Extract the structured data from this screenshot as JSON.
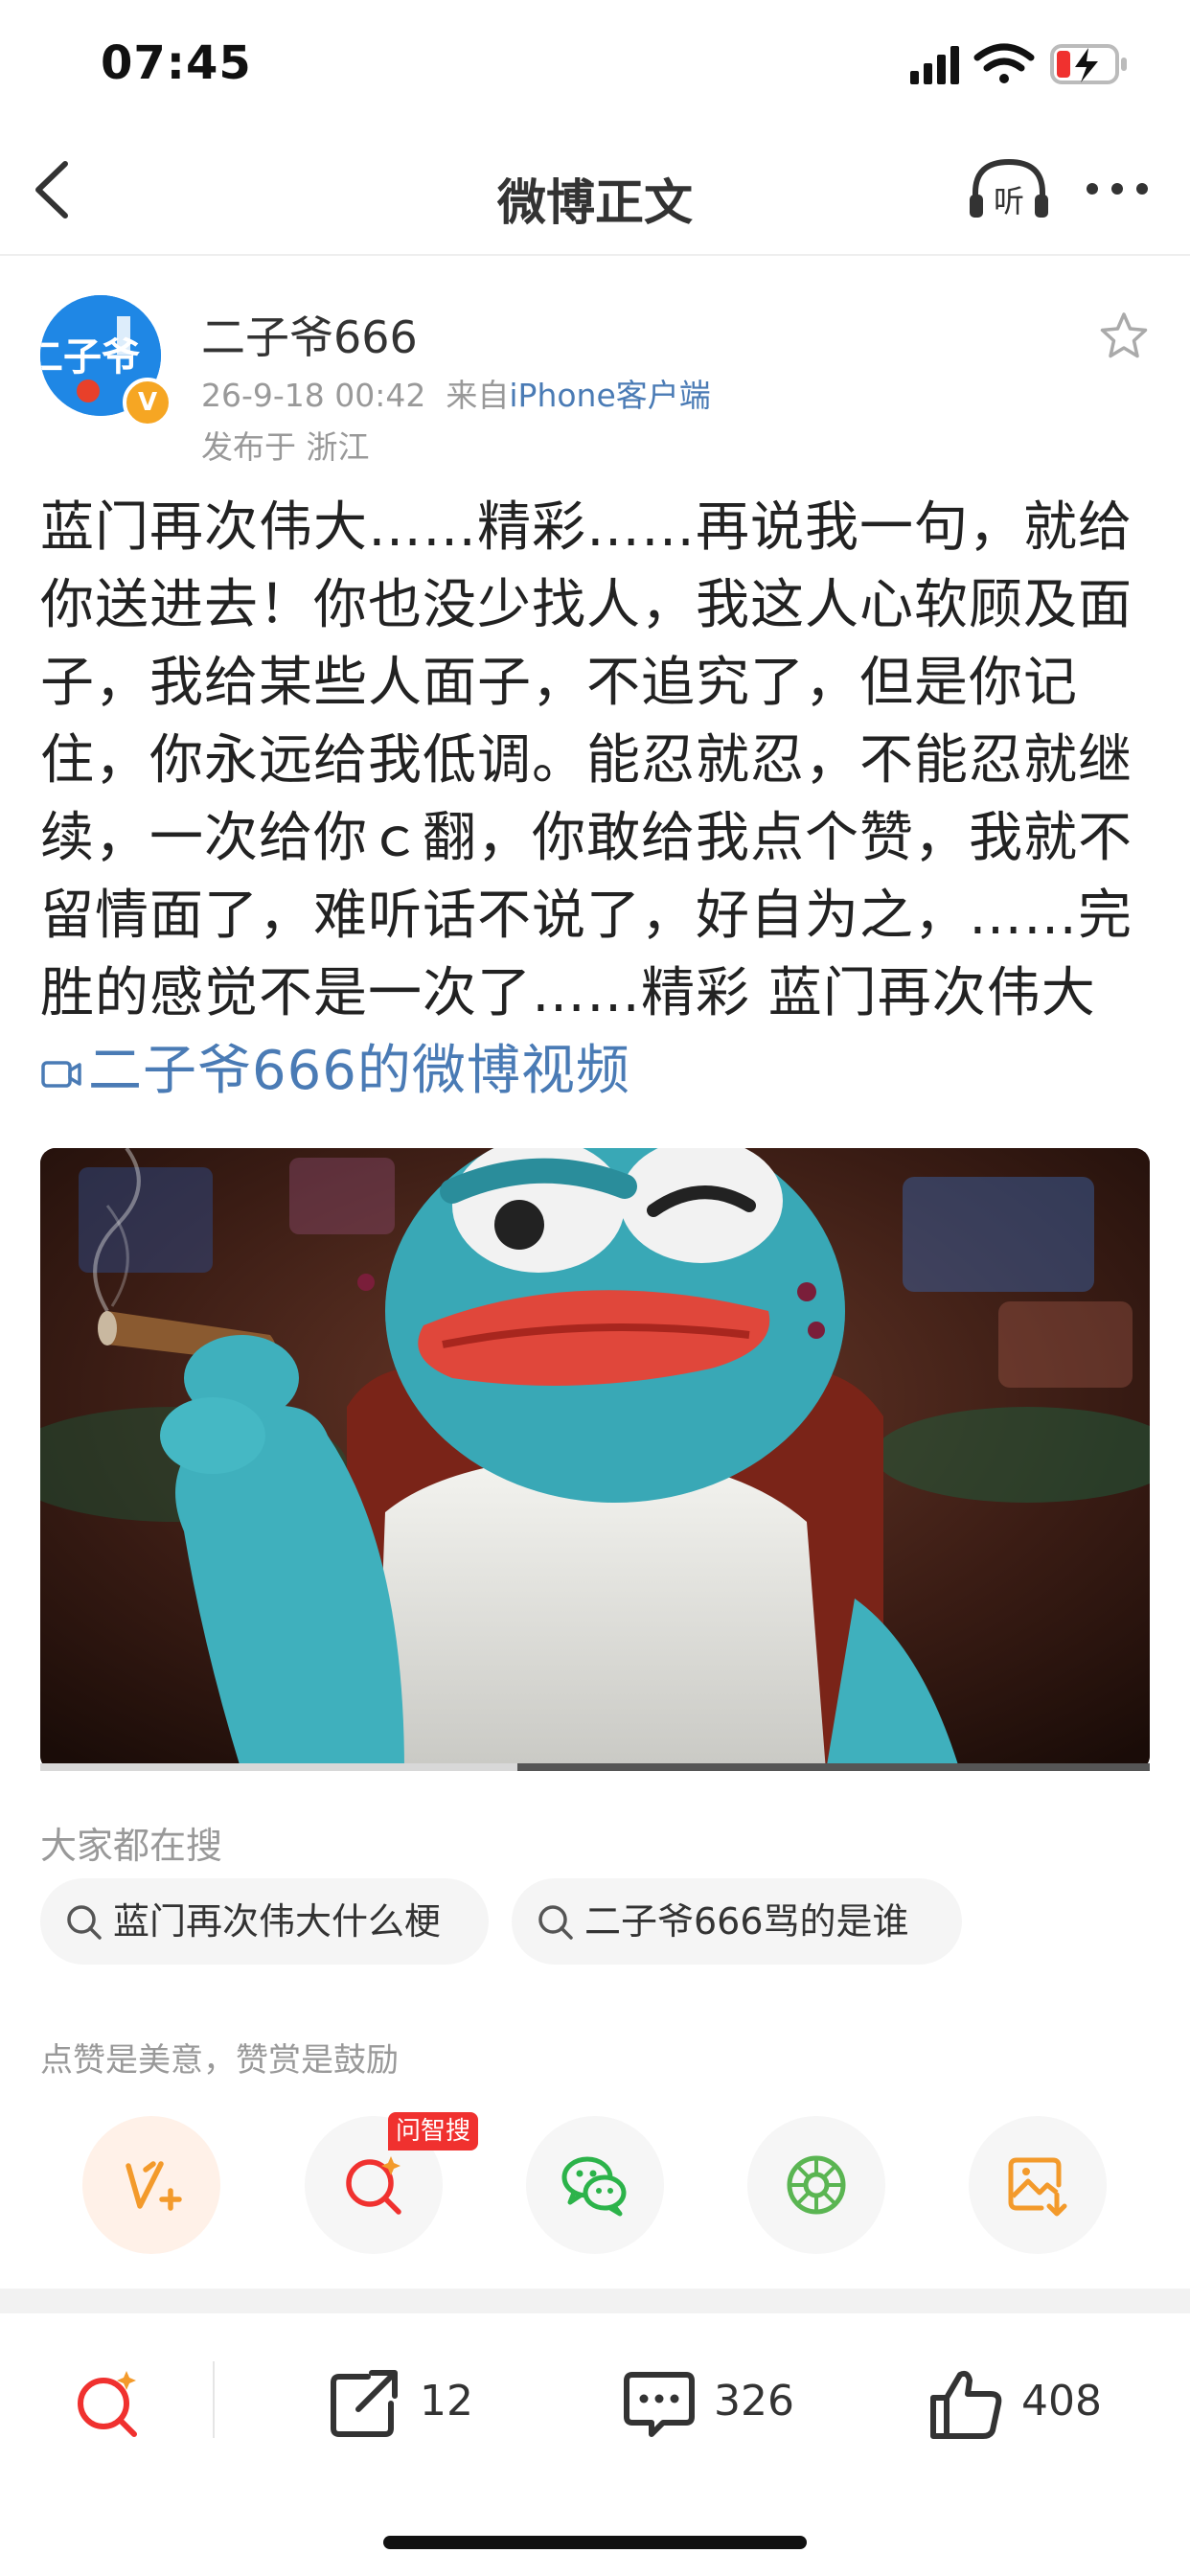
{
  "status_bar": {
    "time": "07:45"
  },
  "nav": {
    "title": "微博正文",
    "listen_label": "听"
  },
  "post": {
    "username": "二子爷666",
    "timestamp": "26-9-18 00:42",
    "source_prefix": "来自",
    "source": "iPhone客户端",
    "location": "发布于 浙江",
    "body": "蓝门再次伟大……精彩……再说我一句，就给你送进去！你也没少找人，我这人心软顾及面子，我给某些人面子，不追究了，但是你记住，你永远给我低调。能忍就忍，不能忍就继续，一次给你ｃ翻，你敢给我点个赞，我就不留情面了，难听话不说了，好自为之，……完胜的感觉不是一次了……精彩 蓝门再次伟大",
    "video_link": "二子爷666的微博视频",
    "avatar_text": "二子爷",
    "video_progress": 0.43
  },
  "searches": {
    "title": "大家都在搜",
    "items": [
      "蓝门再次伟大什么梗",
      "二子爷666骂的是谁"
    ]
  },
  "reward": {
    "tip": "点赞是美意，赞赏是鼓励",
    "ai_badge": "问智搜",
    "actions": [
      "weibo-reward-icon",
      "ai-search-icon",
      "wechat-icon",
      "moments-icon",
      "save-image-icon"
    ]
  },
  "bottom_bar": {
    "repost_count": "12",
    "comment_count": "326",
    "like_count": "408"
  },
  "colors": {
    "link": "#4a7bb5",
    "accent_orange": "#f39a2b",
    "accent_red": "#f0312f",
    "wechat_green": "#2cb34a"
  }
}
